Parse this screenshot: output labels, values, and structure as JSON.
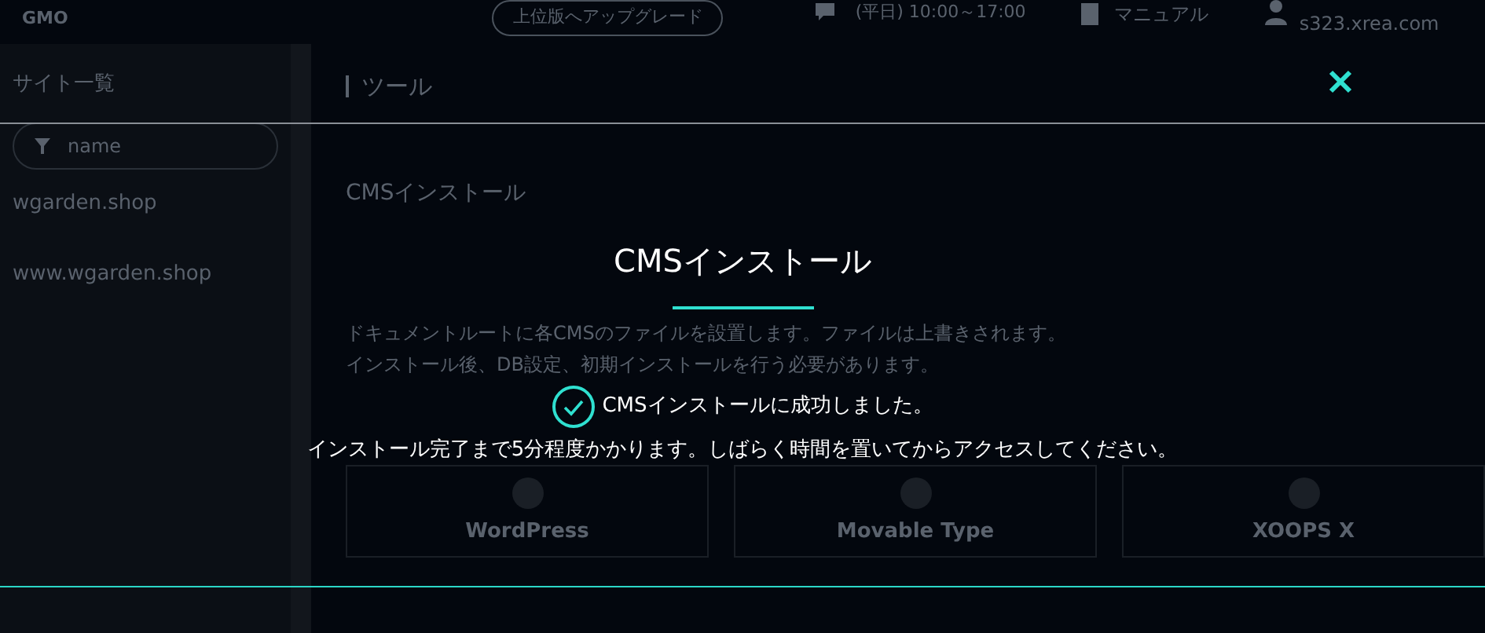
{
  "topbar": {
    "logo": "GMO",
    "upgrade_button": "上位版へアップグレード",
    "support_hours": "(平日) 10:00～17:00",
    "manual_link": "マニュアル",
    "account": "s323.xrea.com"
  },
  "sidebar": {
    "title": "サイト一覧",
    "filter": {
      "placeholder": "name"
    },
    "sites": [
      "wgarden.shop",
      "www.wgarden.shop"
    ]
  },
  "main": {
    "heading": "ツール",
    "section_title": "CMSインストール",
    "description": [
      "ドキュメントルートに各CMSのファイルを設置します。ファイルは上書きされます。",
      "インストール後、DB設定、初期インストールを行う必要があります。"
    ],
    "cms_options": [
      "WordPress",
      "Movable Type",
      "XOOPS X"
    ]
  },
  "modal": {
    "title": "CMSインストール",
    "message": "CMSインストールに成功しました。",
    "note": "インストール完了まで5分程度かかります。しばらく時間を置いてからアクセスしてください。"
  }
}
